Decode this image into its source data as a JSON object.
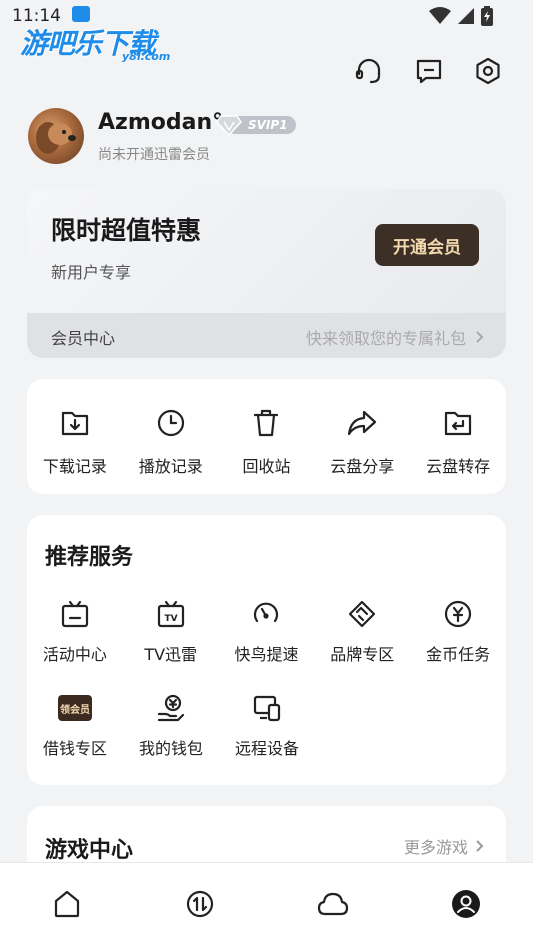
{
  "status_bar": {
    "time": "11:14"
  },
  "watermark": {
    "main": "游吧乐下载",
    "sub": "y8l.com"
  },
  "header_icons": [
    "headset-icon",
    "message-icon",
    "settings-icon"
  ],
  "user": {
    "name": "Azmodan°",
    "badge": "SVIP1",
    "status": "尚未开通迅雷会员"
  },
  "vip_card": {
    "title": "限时超值特惠",
    "subtitle": "新用户专享",
    "button": "开通会员",
    "center_label": "会员中心",
    "promo": "快来领取您的专属礼包"
  },
  "quick_actions": [
    {
      "label": "下载记录",
      "icon": "download-folder-icon"
    },
    {
      "label": "播放记录",
      "icon": "clock-icon"
    },
    {
      "label": "回收站",
      "icon": "trash-icon"
    },
    {
      "label": "云盘分享",
      "icon": "share-icon"
    },
    {
      "label": "云盘转存",
      "icon": "transfer-folder-icon"
    }
  ],
  "services": {
    "title": "推荐服务",
    "items": [
      {
        "label": "活动中心",
        "icon": "activity-tv-icon"
      },
      {
        "label": "TV迅雷",
        "icon": "tv-icon"
      },
      {
        "label": "快鸟提速",
        "icon": "speedometer-icon"
      },
      {
        "label": "品牌专区",
        "icon": "handshake-icon"
      },
      {
        "label": "金币任务",
        "icon": "coin-icon"
      },
      {
        "label": "借钱专区",
        "icon": "loan-badge-icon",
        "badge": "领会员"
      },
      {
        "label": "我的钱包",
        "icon": "wallet-hand-icon"
      },
      {
        "label": "远程设备",
        "icon": "devices-icon"
      }
    ]
  },
  "games": {
    "title": "游戏中心",
    "more": "更多游戏"
  },
  "tabbar": [
    "home-icon",
    "transfer-icon",
    "cloud-icon",
    "profile-icon"
  ]
}
